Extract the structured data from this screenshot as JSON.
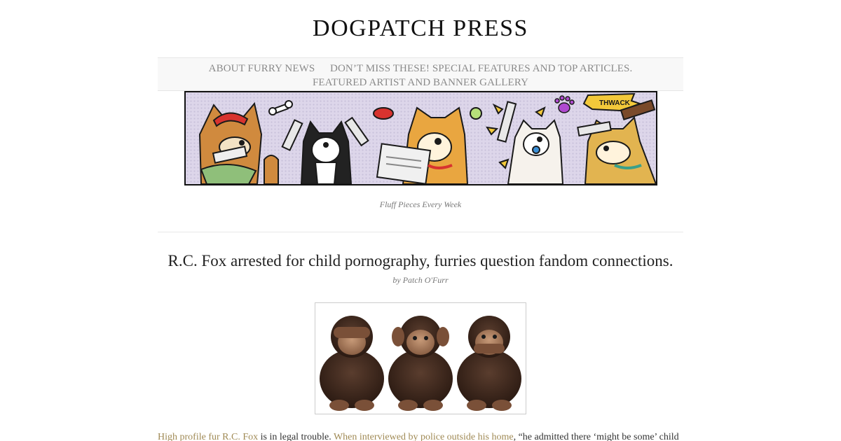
{
  "site": {
    "title": "DOGPATCH  PRESS",
    "tagline": "Fluff Pieces Every Week"
  },
  "nav": {
    "items": [
      {
        "label": "ABOUT FURRY NEWS"
      },
      {
        "label": "DON’T MISS THESE! SPECIAL FEATURES AND TOP ARTICLES."
      },
      {
        "label": "FEATURED ARTIST AND BANNER GALLERY"
      }
    ]
  },
  "banner": {
    "sfx_text": "THWACK"
  },
  "post": {
    "title": "R.C. Fox arrested for child pornography, furries question fandom connections.",
    "byline": "by Patch O'Furr",
    "image_icon": "three-wise-monkeys-image",
    "excerpt": {
      "link1": "High profile fur R.C. Fox",
      "text1": " is in legal trouble. ",
      "link2": "When interviewed by police outside his home",
      "text2": ", “he admitted there ‘might be some’ child"
    }
  },
  "colors": {
    "link": "#a08a55",
    "nav_bg": "#f8f8f8",
    "banner_bg": "#ddd6ea"
  }
}
